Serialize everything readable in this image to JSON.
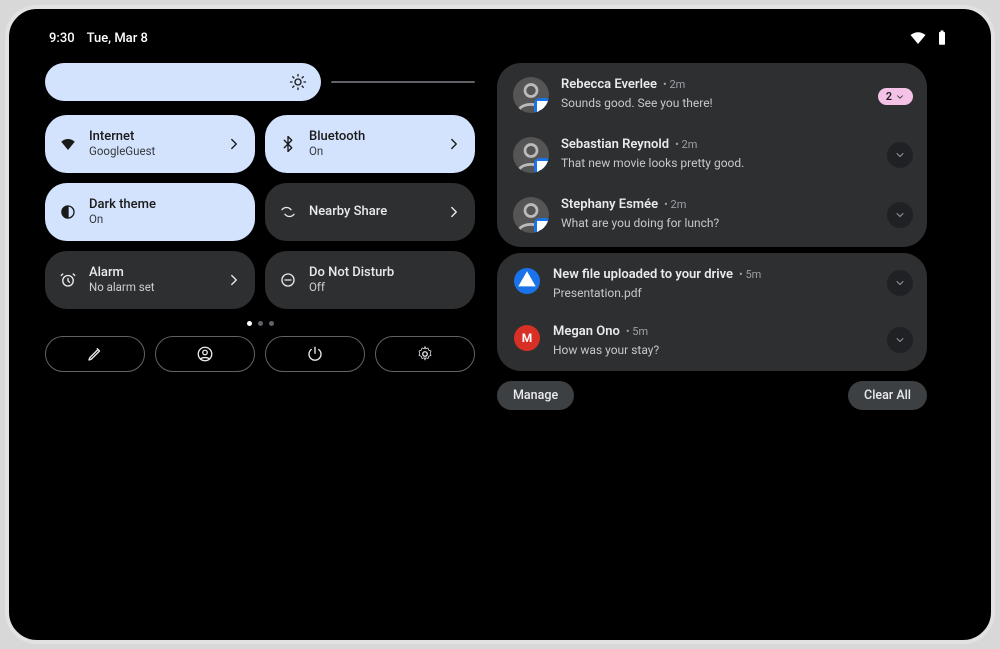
{
  "status": {
    "time": "9:30",
    "date": "Tue, Mar 8"
  },
  "brightness": {
    "percent": 65
  },
  "tiles": [
    {
      "id": "internet",
      "label": "Internet",
      "sub": "GoogleGuest",
      "active": true,
      "chevron": true
    },
    {
      "id": "bluetooth",
      "label": "Bluetooth",
      "sub": "On",
      "active": true,
      "chevron": true
    },
    {
      "id": "darktheme",
      "label": "Dark theme",
      "sub": "On",
      "active": true,
      "chevron": false
    },
    {
      "id": "nearby",
      "label": "Nearby Share",
      "sub": "",
      "active": false,
      "chevron": true
    },
    {
      "id": "alarm",
      "label": "Alarm",
      "sub": "No alarm set",
      "active": false,
      "chevron": true
    },
    {
      "id": "dnd",
      "label": "Do Not Disturb",
      "sub": "Off",
      "active": false,
      "chevron": false
    }
  ],
  "pager": {
    "count": 3,
    "active": 0
  },
  "footer": [
    "edit",
    "user",
    "power",
    "settings"
  ],
  "notifications": {
    "group1": [
      {
        "sender": "Rebecca Everlee",
        "age": "2m",
        "body": "Sounds good. See you there!",
        "count": "2"
      },
      {
        "sender": "Sebastian Reynold",
        "age": "2m",
        "body": "That new movie looks pretty good."
      },
      {
        "sender": "Stephany Esmée",
        "age": "2m",
        "body": "What are you doing for lunch?"
      }
    ],
    "group2": [
      {
        "app": "drive",
        "title": "New file uploaded to your drive",
        "age": "5m",
        "body": "Presentation.pdf"
      },
      {
        "app": "gmail",
        "sender": "Megan Ono",
        "age": "5m",
        "body": "How was your stay?"
      }
    ],
    "manage": "Manage",
    "clear": "Clear All"
  }
}
